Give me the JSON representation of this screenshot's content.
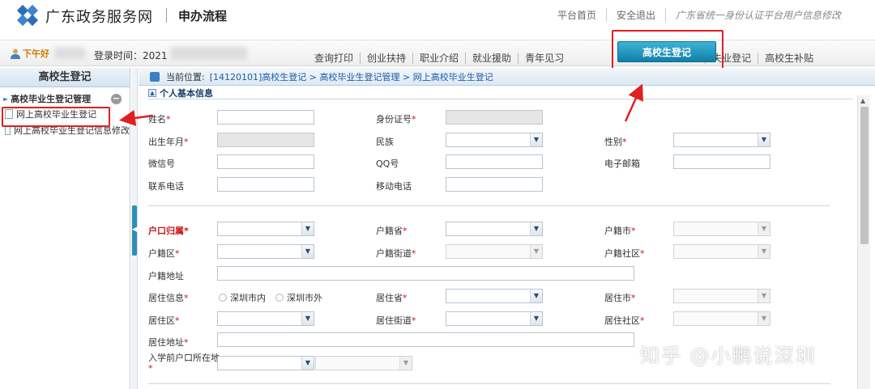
{
  "header": {
    "site_name": "广东政务服务网",
    "page_title": "申办流程",
    "links": [
      "平台首页",
      "安全退出"
    ],
    "note": "广东省统一身份认证平台用户信息修改"
  },
  "navbar": {
    "greeting": "下午好",
    "login_label": "登录时间：2021",
    "tabs": [
      "查询打印",
      "创业扶持",
      "职业介绍",
      "就业援助",
      "青年见习",
      "失业登记",
      "高校生补贴"
    ],
    "active_tab": "高校生登记"
  },
  "sidebar": {
    "title": "高校生登记",
    "group": "高校毕业生登记管理",
    "collapse_symbol": "−",
    "items": [
      "网上高校毕业生登记",
      "网上高校毕业生登记信息修改"
    ]
  },
  "breadcrumb": {
    "label": "当前位置:",
    "path": "[14120101]高校生登记 > 高校毕业生登记管理 > 网上高校毕业生登记"
  },
  "section": {
    "title": "个人基本信息"
  },
  "form": {
    "name": "姓名",
    "id_number": "身份证号",
    "birth": "出生年月",
    "ethnicity": "民族",
    "gender": "性别",
    "wechat": "微信号",
    "qq": "QQ号",
    "email": "电子邮箱",
    "phone": "联系电话",
    "mobile": "移动电话",
    "hukou": "户口归属",
    "hukou_province": "户籍省",
    "hukou_city": "户籍市",
    "hukou_district": "户籍区",
    "hukou_street": "户籍街道",
    "hukou_community": "户籍社区",
    "hukou_address": "户籍地址",
    "residence_info": "居住信息",
    "radio_in": "深圳市内",
    "radio_out": "深圳市外",
    "res_province": "居住省",
    "res_city": "居住市",
    "res_district": "居住区",
    "res_street": "居住街道",
    "res_community": "居住社区",
    "res_address": "居住地址",
    "pre_school_hukou": "入学前户口所在地",
    "required_mark": "*",
    "dropdown_glyph": "▼"
  },
  "watermark": "知乎 @小鹏说深圳",
  "colors": {
    "accent": "#107fa8",
    "highlight": "#e02020",
    "required": "#d01010"
  }
}
